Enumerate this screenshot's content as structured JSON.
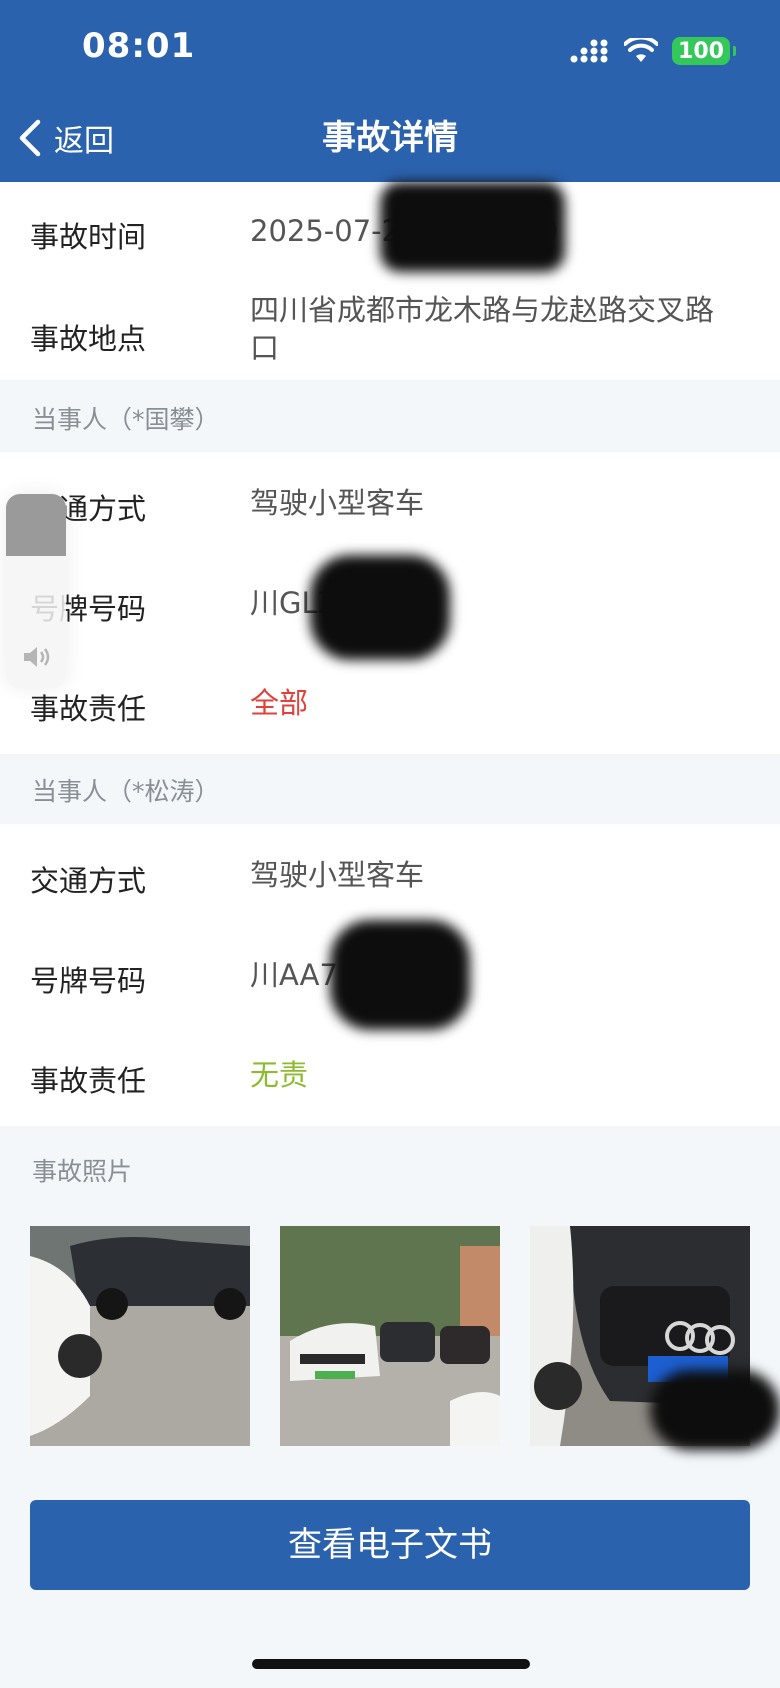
{
  "status_bar": {
    "time": "08:01",
    "battery": "100"
  },
  "nav": {
    "back_label": "返回",
    "title": "事故详情"
  },
  "accident": {
    "time_label": "事故时间",
    "time_value": "2025-07-22 09:40:00",
    "location_label": "事故地点",
    "location_value": "四川省成都市龙木路与龙赵路交叉路口"
  },
  "parties": [
    {
      "header": "当事人（*国攀）",
      "transport_label": "交通方式",
      "transport_value": "驾驶小型客车",
      "plate_label": "号牌号码",
      "plate_value": "川GLZX93",
      "responsibility_label": "事故责任",
      "responsibility_value": "全部",
      "responsibility_color": "#e0413a"
    },
    {
      "header": "当事人（*松涛）",
      "transport_label": "交通方式",
      "transport_value": "驾驶小型客车",
      "plate_label": "号牌号码",
      "plate_value": "川AA7",
      "responsibility_label": "事故责任",
      "responsibility_value": "无责",
      "responsibility_color": "#8dbb2f"
    }
  ],
  "photos": {
    "header": "事故照片"
  },
  "actions": {
    "view_document": "查看电子文书"
  },
  "volume_hud": {
    "level": 0.32
  }
}
